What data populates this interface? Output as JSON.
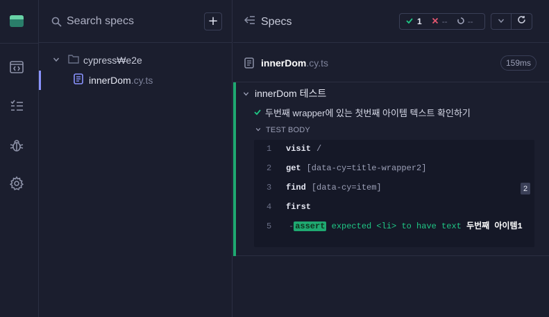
{
  "nav": {
    "items": [
      {
        "name": "runs",
        "icon": "code-window-icon"
      },
      {
        "name": "specs",
        "icon": "list-icon"
      },
      {
        "name": "debug",
        "icon": "bug-icon"
      },
      {
        "name": "settings",
        "icon": "gear-icon"
      }
    ]
  },
  "specs_pane": {
    "search_placeholder": "Search specs",
    "add_label": "+",
    "folder": "cypress₩e2e",
    "file_name": "innerDom",
    "file_ext": ".cy.ts"
  },
  "reporter": {
    "title": "Specs",
    "stats": {
      "passed": "1",
      "failed": "--",
      "pending": "--"
    },
    "spec_name": "innerDom",
    "spec_ext": ".cy.ts",
    "duration": "159ms",
    "suite_title": "innerDom 테스트",
    "test_title": "두번째 wrapper에 있는 첫번째 아이템 텍스트 확인하기",
    "body_label": "TEST BODY",
    "commands": [
      {
        "num": "1",
        "name": "visit",
        "msg": "/"
      },
      {
        "num": "2",
        "name": "get",
        "msg": "[data-cy=title-wrapper2]"
      },
      {
        "num": "3",
        "name": "find",
        "msg": "[data-cy=item]",
        "badge": "2"
      },
      {
        "num": "4",
        "name": "first",
        "msg": ""
      },
      {
        "num": "5",
        "name": "",
        "msg": ""
      }
    ],
    "assert": {
      "prefix": "-",
      "tag": "assert",
      "text": " expected <li> to have text ",
      "value": "두번째 아이템1"
    },
    "colors": {
      "pass": "#1fa971",
      "fail": "#e45770",
      "accent": "#8a93ff"
    }
  }
}
